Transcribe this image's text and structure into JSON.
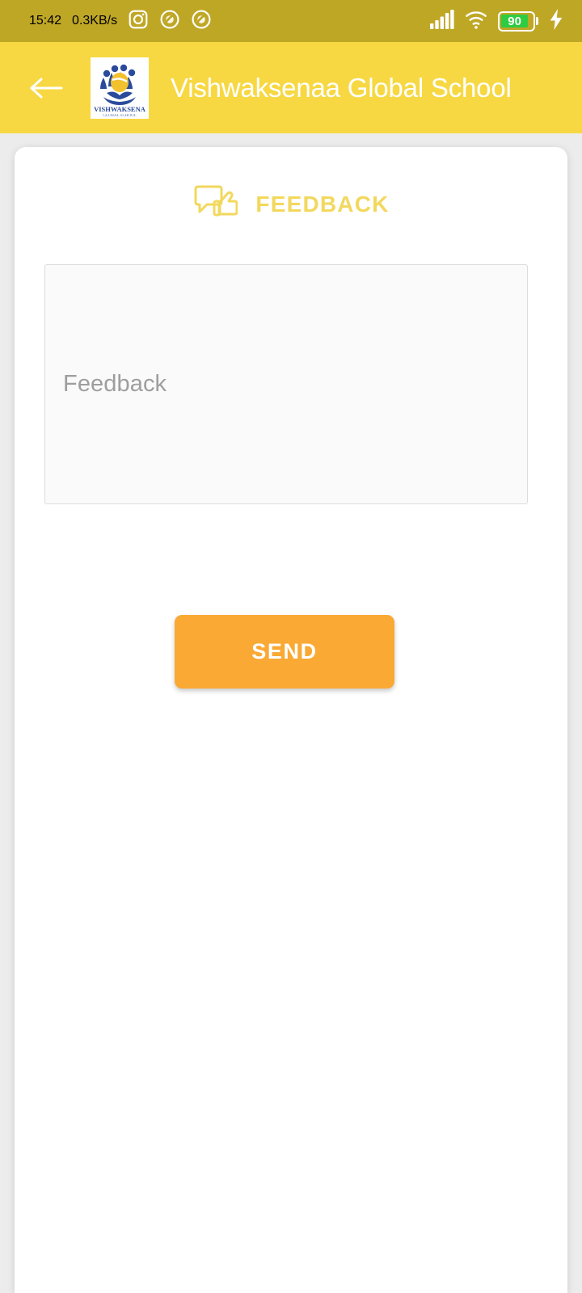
{
  "status_bar": {
    "time": "15:42",
    "network_speed": "0.3KB/s",
    "battery_percent": "90",
    "background_color": "#bfa726",
    "icons": [
      "instagram-icon",
      "do-not-disturb-icon",
      "data-saver-icon",
      "signal-bars-icon",
      "wifi-icon",
      "battery-icon",
      "charging-bolt-icon"
    ]
  },
  "app_bar": {
    "back_label": "back-arrow",
    "logo_text": "VISHWAKSENA",
    "title": "Vishwaksenaa Global School",
    "background_color": "#f7d842",
    "title_color": "#ffffff"
  },
  "main": {
    "section": {
      "icon": "feedback-thumbs-up-icon",
      "title": "FEEDBACK",
      "title_color": "#f2d85e"
    },
    "feedback_input": {
      "placeholder": "Feedback",
      "value": "",
      "background_color": "#fafafa",
      "border_color": "#dcdcdc"
    },
    "send_button": {
      "label": "SEND",
      "background_color": "#f9a934",
      "text_color": "#ffffff"
    }
  }
}
